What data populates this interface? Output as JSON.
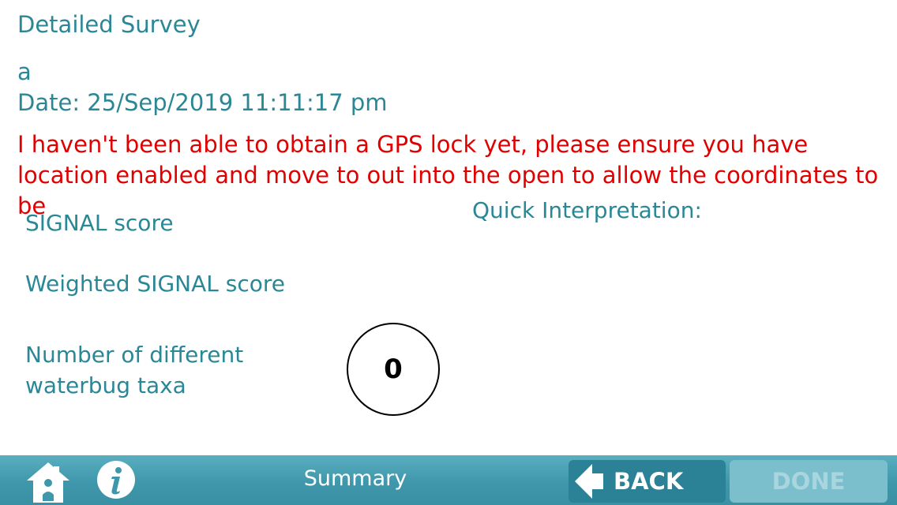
{
  "header": {
    "title": "Detailed Survey",
    "site_name": "a",
    "date": "Date: 25/Sep/2019 11:11:17 pm"
  },
  "gps_warning": "I haven't been able to obtain a GPS lock yet, please ensure you have location enabled and move to out into the open to allow the coordinates to be",
  "scores": {
    "signal_label": "SIGNAL score",
    "weighted_label": "Weighted SIGNAL score",
    "taxa_label": "Number of different waterbug taxa",
    "taxa_value": "0"
  },
  "interpretation": {
    "label": "Quick Interpretation:"
  },
  "bottom_bar": {
    "home_icon": "home-icon",
    "info_icon": "info-icon",
    "title": "Summary",
    "back_label": "BACK",
    "done_label": "DONE",
    "colors": {
      "bar": "#3f97ab",
      "back_button": "#2b8196",
      "done_button_disabled": "#7bbfcd"
    }
  },
  "colors": {
    "text_teal": "#2a8796",
    "warning_red": "#e00000"
  }
}
